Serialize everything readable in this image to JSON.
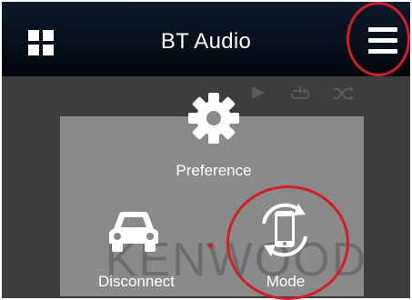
{
  "header": {
    "title": "BT Audio",
    "left_icon": "apps-grid-icon",
    "right_icon": "hamburger-menu-icon"
  },
  "status": {
    "icons": [
      "play-icon",
      "repeat-one-icon",
      "shuffle-icon"
    ]
  },
  "menu_panel": {
    "items": [
      {
        "label": "Preference",
        "icon": "gear-icon"
      },
      {
        "label": "Disconnect",
        "icon": "car-icon"
      },
      {
        "label": "Mode",
        "icon": "phone-rotate-icon"
      }
    ]
  },
  "watermark": {
    "text": "KENWOOD"
  },
  "colors": {
    "topbar": "#02060c",
    "panel": "#8a8a8a",
    "highlight_ring": "#d21e2a",
    "background": "#3d3d3d"
  }
}
